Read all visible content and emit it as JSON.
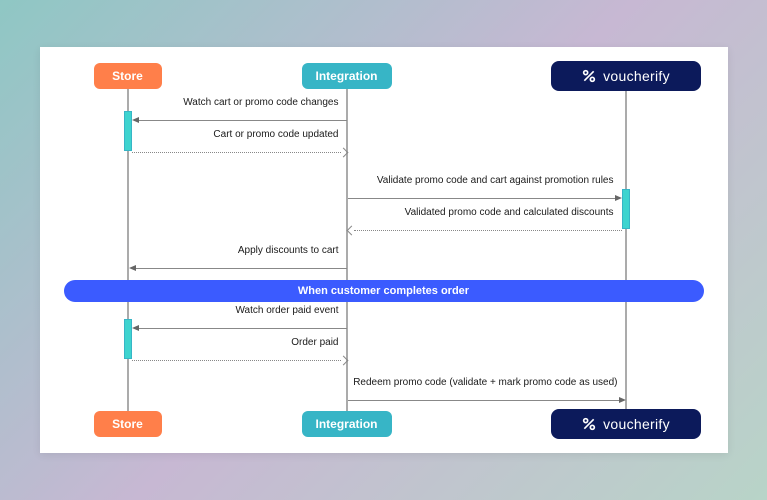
{
  "participants": {
    "store": "Store",
    "integration": "Integration",
    "voucherify": "voucherify"
  },
  "messages": {
    "m1": "Watch cart or promo code changes",
    "m2": "Cart or promo code updated",
    "m3": "Validate promo code and cart against promotion rules",
    "m4": "Validated promo code and calculated discounts",
    "m5": "Apply discounts to cart",
    "m6": "Watch order paid event",
    "m7": "Order paid",
    "m8": "Redeem promo code (validate + mark promo code as used)"
  },
  "divider": "When customer completes order"
}
